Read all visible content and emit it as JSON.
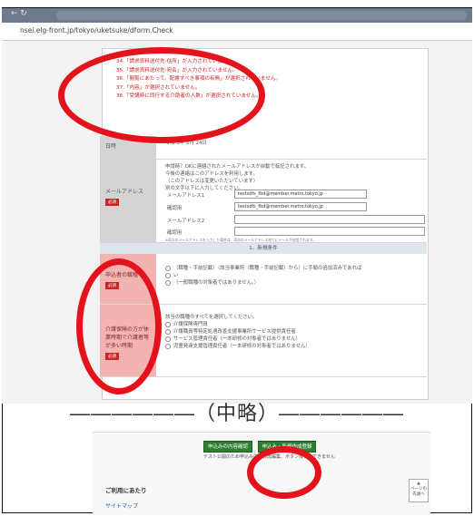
{
  "browser": {
    "back_label": "← ↻",
    "url": "nsei.elg-front.jp/tokyo/uketsuke/dform.Check"
  },
  "errors": [
    "34.「請求資料送付先-住所」が入力されていません。",
    "35.「請求資料送付先-宛名」が入力されていません。",
    "36.「閲覧にあたって、配慮すべき事項の有無」が選択されていません。",
    "37.「内容」が選択されていません。",
    "38.「受講時に同行する介助者の人数」が選択されていません。"
  ],
  "date_row": {
    "label": "日時",
    "value": "令和 3年 5月 24日"
  },
  "mail_row": {
    "label": "メールアドレス",
    "required": "必須",
    "intro": [
      "申請時？OKに連絡されたメールアドレスが自動で転記されます。",
      "今後の連絡はこのアドレスを利用します。",
      "（このアドレスは変更いただいています）",
      "別の文字以下に入力してください。"
    ],
    "addr1_label": "メールアドレス1",
    "addr1_value": "testsdfs_fbd@member.metro.tokyo.jp",
    "confirm_label": "確認用",
    "confirm_value": "testsdfs_fbd@member.metro.tokyo.jp",
    "addr2_label": "メールアドレス2",
    "confirm2_label": "確認用",
    "footnote1": "※両方のメールアドレスを入力した場合は、両方のメールアドレス宛てにメールが送信されます。",
    "footnote2": "※メールの受信制限（ドメイン指定受信など）をしている場合は、@tokyo.jpを受信できるように設定してください。"
  },
  "section_heading": "1．新規条件",
  "applicant_row": {
    "label": "申込者の職種",
    "required": "必須",
    "options": [
      "（職種・手前記載）（該当事業所（職種・手前記載）から）に手順の追加済みであれば",
      "い",
      "（一般職種の対象者ではありません。）"
    ]
  },
  "helper_row": {
    "label": "介護保険の方が休業時期で介護者等が多い時期",
    "required": "必須",
    "intro": "該当の職種のすべてを選択してください。",
    "options": [
      "介護保険専門員",
      "介護職員等特定処遇改善支援事業所サービス提供責任者",
      "サービス管理責任者（一本研修の対象者ではありません）",
      "児童発達支援管理責任者（一本研修の対象者ではありません）"
    ]
  },
  "omission": "――――――（中略）――――――",
  "bottom": {
    "back_button": "申込みの内容確認",
    "submit_button": "申込み・新規作成登録",
    "note": "テスト公開のため申込み内容の再編集、ボタン操作はできません",
    "footer_title": "ご利用にあたり",
    "footer_link": "サイトマップ",
    "totop_label": "ページの先頭へ"
  }
}
